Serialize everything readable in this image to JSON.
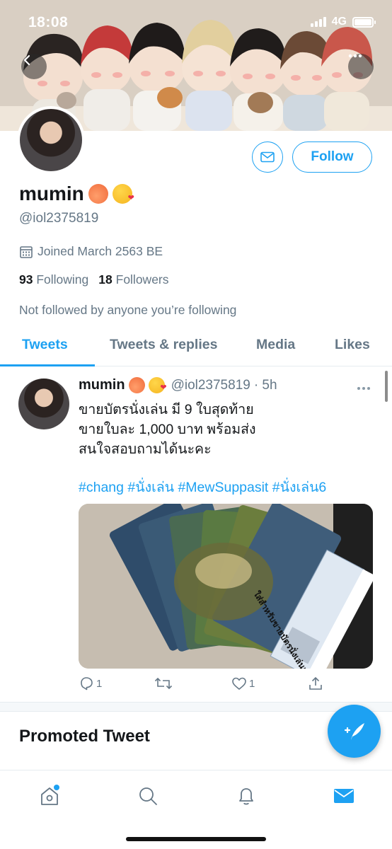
{
  "status_bar": {
    "time": "18:08",
    "network": "4G"
  },
  "profile": {
    "display_name": "mumin",
    "name_emojis": [
      "peach-emoji",
      "kissing-heart-emoji"
    ],
    "handle": "@iol2375819",
    "joined": "Joined March 2563 BE",
    "following_count": "93",
    "following_label": "Following",
    "followers_count": "18",
    "followers_label": "Followers",
    "not_followed": "Not followed by anyone you’re following",
    "follow_button": "Follow"
  },
  "tabs": [
    {
      "label": "Tweets",
      "active": true
    },
    {
      "label": "Tweets & replies",
      "active": false
    },
    {
      "label": "Media",
      "active": false
    },
    {
      "label": "Likes",
      "active": false
    }
  ],
  "tweet": {
    "author_name": "mumin",
    "author_handle": "@iol2375819",
    "time": "· 5h",
    "lines": [
      "ขายบัตรนั่งเล่น มี 9 ใบสุดท้าย",
      "ขายใบละ 1,000 บาท พร้อมส่ง",
      "สนใจสอบถามได้นะคะ"
    ],
    "hashtags": "#chang #นั่งเล่น #MewSuppasit #นั่งเล่น6",
    "image_caption": "ใส่สำหรับขายบัตรนั่งเล่นเท่านั้น",
    "reply_count": "1",
    "like_count": "1"
  },
  "promoted": {
    "label": "Promoted Tweet"
  },
  "colors": {
    "accent": "#1da1f2",
    "text": "#14171a",
    "secondary": "#657786"
  },
  "icons": [
    "back-icon",
    "more-icon",
    "mail-icon",
    "calendar-icon",
    "reply-icon",
    "retweet-icon",
    "like-icon",
    "share-icon",
    "compose-icon",
    "home-icon",
    "search-icon",
    "notifications-icon",
    "messages-icon"
  ]
}
